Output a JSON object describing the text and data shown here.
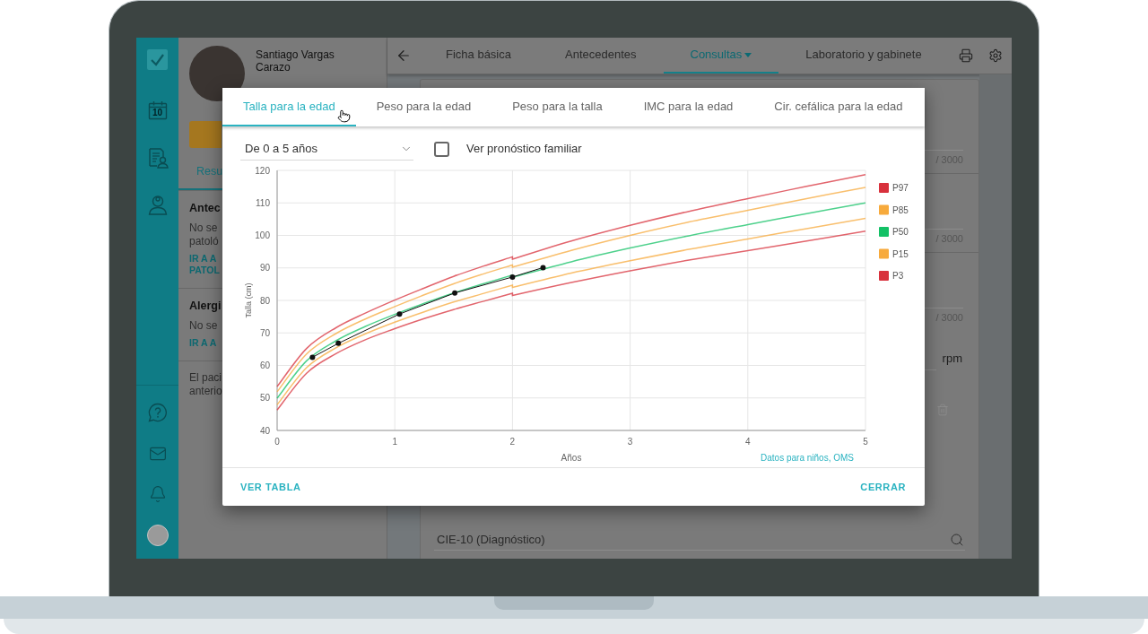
{
  "sidebar": {
    "calendar_day": "10"
  },
  "patient_panel": {
    "name": "Santiago Vargas Carazo",
    "tabs": [
      {
        "label": "Resu",
        "selected": true
      }
    ],
    "sections": [
      {
        "title": "Antec",
        "text_lines": [
          "No se",
          "patoló"
        ],
        "link_lines": [
          "IR A A",
          "PATOL"
        ]
      },
      {
        "title": "Alergi",
        "text_lines": [
          "No se"
        ],
        "link_lines": [
          "IR A A"
        ]
      },
      {
        "text_lines": [
          "El paci",
          "anterio"
        ]
      }
    ]
  },
  "top_bar": {
    "tabs": [
      {
        "label": "Ficha básica",
        "selected": false,
        "menu": false
      },
      {
        "label": "Antecedentes",
        "selected": false,
        "menu": false
      },
      {
        "label": "Consultas",
        "selected": true,
        "menu": true
      },
      {
        "label": "Laboratorio y gabinete",
        "selected": false,
        "menu": false
      }
    ]
  },
  "consultation_card": {
    "counters": [
      "/ 3000",
      "/ 3000",
      "/ 3000"
    ],
    "unit": "rpm",
    "diagnosis_field": {
      "placeholder": "CIE-10 (Diagnóstico)"
    }
  },
  "dialog": {
    "tabs": [
      {
        "label": "Talla para la edad",
        "selected": true
      },
      {
        "label": "Peso para la edad",
        "selected": false
      },
      {
        "label": "Peso para la talla",
        "selected": false
      },
      {
        "label": "IMC para la edad",
        "selected": false
      },
      {
        "label": "Cir. cefálica para la edad",
        "selected": false
      }
    ],
    "age_range": {
      "value": "De 0 a 5 años"
    },
    "family_forecast": {
      "label": "Ver pronóstico familiar",
      "checked": false
    },
    "chart_data": {
      "type": "line",
      "xlabel": "Años",
      "ylabel": "Talla (cm)",
      "xlim": [
        0,
        5
      ],
      "ylim": [
        40,
        120
      ],
      "xticks": [
        0,
        1,
        2,
        3,
        4,
        5
      ],
      "yticks": [
        40,
        50,
        60,
        70,
        80,
        90,
        100,
        110,
        120
      ],
      "grid": true,
      "legend": "right",
      "x": [
        0,
        0.25,
        0.5,
        0.75,
        1,
        1.25,
        1.5,
        1.75,
        2,
        2,
        2.5,
        3,
        3.5,
        4,
        4.5,
        5
      ],
      "series": [
        {
          "name": "P97",
          "color": "#d8313c",
          "values": [
            53.5,
            65.2,
            71.6,
            76.1,
            80.1,
            83.8,
            87.4,
            90.5,
            93.4,
            92.7,
            98.3,
            103.1,
            107.4,
            111.3,
            115.1,
            118.7
          ]
        },
        {
          "name": "P85",
          "color": "#f7aa3c",
          "values": [
            51.9,
            63.5,
            69.8,
            74.3,
            78.1,
            81.7,
            85.1,
            88.1,
            90.9,
            90.2,
            95.4,
            100.0,
            104.1,
            107.7,
            111.3,
            114.8
          ]
        },
        {
          "name": "P50",
          "color": "#13c166",
          "values": [
            49.9,
            61.4,
            67.6,
            72.0,
            75.7,
            79.1,
            82.3,
            85.1,
            87.8,
            87.1,
            91.9,
            96.1,
            99.9,
            103.3,
            106.7,
            110.0
          ]
        },
        {
          "name": "P15",
          "color": "#f7aa3c",
          "values": [
            47.9,
            59.3,
            65.4,
            69.7,
            73.3,
            76.5,
            79.5,
            82.1,
            84.7,
            84.0,
            88.4,
            92.2,
            95.7,
            98.9,
            102.1,
            105.2
          ]
        },
        {
          "name": "P3",
          "color": "#d8313c",
          "values": [
            46.3,
            57.6,
            63.6,
            67.9,
            71.3,
            74.4,
            77.2,
            79.7,
            82.2,
            81.5,
            85.5,
            89.1,
            92.4,
            95.3,
            98.3,
            101.3
          ]
        },
        {
          "color": "#111111",
          "marker": "circle",
          "x": [
            0.3,
            0.52,
            1.04,
            1.51,
            2.0,
            2.26
          ],
          "values": [
            62.5,
            66.8,
            75.8,
            82.3,
            87.2,
            90.1
          ]
        }
      ]
    },
    "source_link": "Datos para niños, OMS",
    "buttons": [
      "VER TABLA",
      "CERRAR"
    ]
  }
}
